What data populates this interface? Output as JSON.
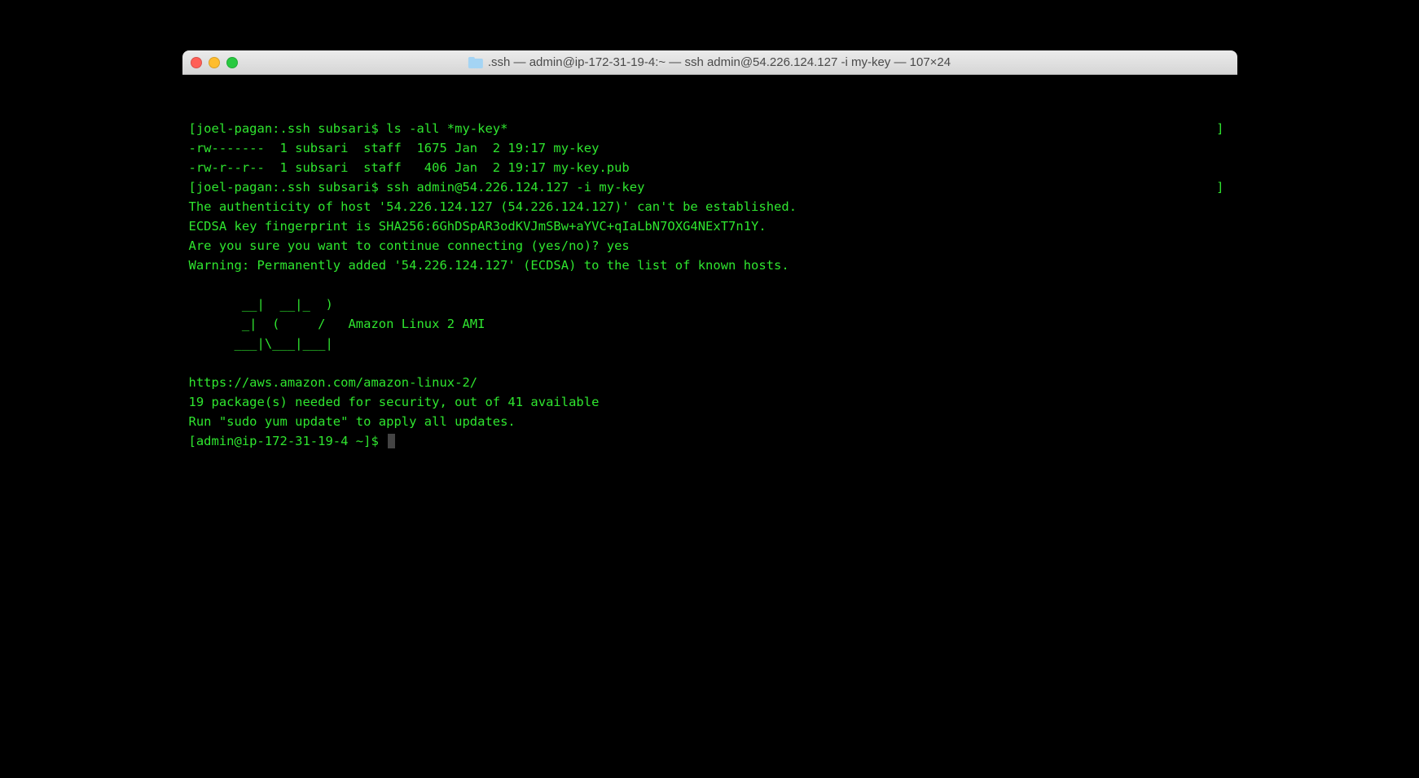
{
  "window": {
    "title": ".ssh — admin@ip-172-31-19-4:~ — ssh admin@54.226.124.127 -i my-key — 107×24"
  },
  "terminal": {
    "lines": [
      {
        "text": "[joel-pagan:.ssh subsari$ ls -all *my-key*",
        "hasRightBracket": true
      },
      {
        "text": "-rw-------  1 subsari  staff  1675 Jan  2 19:17 my-key",
        "hasRightBracket": false
      },
      {
        "text": "-rw-r--r--  1 subsari  staff   406 Jan  2 19:17 my-key.pub",
        "hasRightBracket": false
      },
      {
        "text": "[joel-pagan:.ssh subsari$ ssh admin@54.226.124.127 -i my-key",
        "hasRightBracket": true
      },
      {
        "text": "The authenticity of host '54.226.124.127 (54.226.124.127)' can't be established.",
        "hasRightBracket": false
      },
      {
        "text": "ECDSA key fingerprint is SHA256:6GhDSpAR3odKVJmSBw+aYVC+qIaLbN7OXG4NExT7n1Y.",
        "hasRightBracket": false
      },
      {
        "text": "Are you sure you want to continue connecting (yes/no)? yes",
        "hasRightBracket": false
      },
      {
        "text": "Warning: Permanently added '54.226.124.127' (ECDSA) to the list of known hosts.",
        "hasRightBracket": false
      },
      {
        "text": "",
        "hasRightBracket": false
      },
      {
        "text": "       __|  __|_  )",
        "hasRightBracket": false
      },
      {
        "text": "       _|  (     /   Amazon Linux 2 AMI",
        "hasRightBracket": false
      },
      {
        "text": "      ___|\\___|___|",
        "hasRightBracket": false
      },
      {
        "text": "",
        "hasRightBracket": false
      },
      {
        "text": "https://aws.amazon.com/amazon-linux-2/",
        "hasRightBracket": false
      },
      {
        "text": "19 package(s) needed for security, out of 41 available",
        "hasRightBracket": false
      },
      {
        "text": "Run \"sudo yum update\" to apply all updates.",
        "hasRightBracket": false
      },
      {
        "text": "[admin@ip-172-31-19-4 ~]$ ",
        "hasRightBracket": false,
        "hasCursor": true
      }
    ]
  }
}
